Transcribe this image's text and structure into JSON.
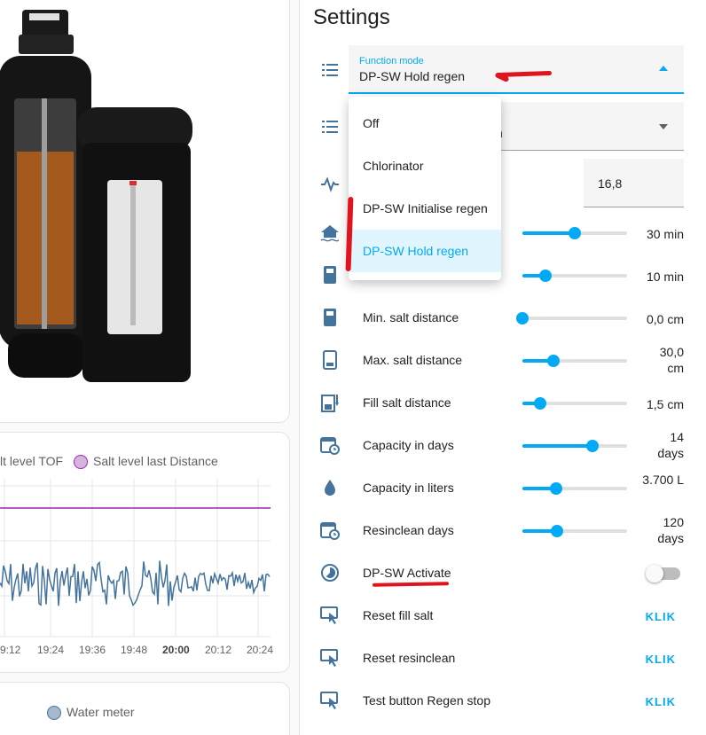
{
  "settings": {
    "title": "Settings",
    "function_mode": {
      "label": "Function mode",
      "value": "DP-SW Hold regen",
      "options": [
        "Off",
        "Chlorinator",
        "DP-SW Initialise regen",
        "DP-SW Hold regen"
      ],
      "selected_index": 3
    },
    "second_select_partial": "n",
    "number_input_value": "16,8",
    "rows": [
      {
        "id": "row-regen-1",
        "label": "",
        "value": "30 min",
        "fraction": 0.5
      },
      {
        "id": "row-regen-2",
        "label": "",
        "value": "10 min",
        "fraction": 0.22
      },
      {
        "id": "min-salt-distance",
        "label": "Min. salt distance",
        "value": "0,0 cm",
        "fraction": 0.0
      },
      {
        "id": "max-salt-distance",
        "label": "Max. salt distance",
        "value": "30,0 cm",
        "fraction": 0.3
      },
      {
        "id": "fill-salt-distance",
        "label": "Fill salt distance",
        "value": "1,5 cm",
        "fraction": 0.17
      },
      {
        "id": "capacity-days",
        "label": "Capacity in days",
        "value": "14 days",
        "fraction": 0.67
      },
      {
        "id": "capacity-liters",
        "label": "Capacity in liters",
        "value": "3.700 L",
        "fraction": 0.32
      },
      {
        "id": "resinclean-days",
        "label": "Resinclean days",
        "value": "120 days",
        "fraction": 0.33
      }
    ],
    "toggle": {
      "label": "DP-SW Activate",
      "on": false
    },
    "buttons": [
      {
        "label": "Reset fill salt",
        "action": "KLIK"
      },
      {
        "label": "Reset resinclean",
        "action": "KLIK"
      },
      {
        "label": "Test button Regen stop",
        "action": "KLIK"
      }
    ]
  },
  "chart": {
    "legend": [
      "lt level TOF",
      "Salt level last Distance"
    ],
    "x_ticks": [
      "9:12",
      "19:24",
      "19:36",
      "19:48",
      "20:00",
      "20:12",
      "20:24"
    ]
  },
  "water_meter": {
    "legend": "Water meter"
  },
  "colors": {
    "accent": "#03a9f4",
    "icon": "#44739e",
    "purple": "#9c27b0",
    "series": "#44739e",
    "annotation": "#e0141e"
  }
}
